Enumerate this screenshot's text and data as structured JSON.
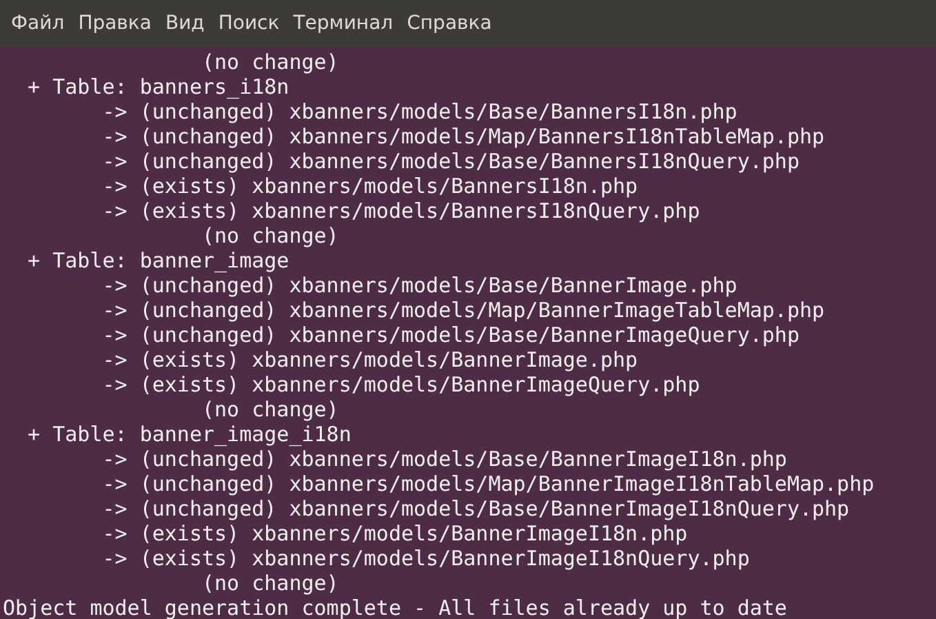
{
  "menu": [
    "Файл",
    "Правка",
    "Вид",
    "Поиск",
    "Терминал",
    "Справка"
  ],
  "terminal_lines": [
    "                (no change)",
    "  + Table: banners_i18n",
    "        -> (unchanged) xbanners/models/Base/BannersI18n.php",
    "        -> (unchanged) xbanners/models/Map/BannersI18nTableMap.php",
    "        -> (unchanged) xbanners/models/Base/BannersI18nQuery.php",
    "        -> (exists) xbanners/models/BannersI18n.php",
    "        -> (exists) xbanners/models/BannersI18nQuery.php",
    "                (no change)",
    "  + Table: banner_image",
    "        -> (unchanged) xbanners/models/Base/BannerImage.php",
    "        -> (unchanged) xbanners/models/Map/BannerImageTableMap.php",
    "        -> (unchanged) xbanners/models/Base/BannerImageQuery.php",
    "        -> (exists) xbanners/models/BannerImage.php",
    "        -> (exists) xbanners/models/BannerImageQuery.php",
    "                (no change)",
    "  + Table: banner_image_i18n",
    "        -> (unchanged) xbanners/models/Base/BannerImageI18n.php",
    "        -> (unchanged) xbanners/models/Map/BannerImageI18nTableMap.php",
    "        -> (unchanged) xbanners/models/Base/BannerImageI18nQuery.php",
    "        -> (exists) xbanners/models/BannerImageI18n.php",
    "        -> (exists) xbanners/models/BannerImageI18nQuery.php",
    "                (no change)",
    "Object model generation complete - All files already up to date"
  ]
}
